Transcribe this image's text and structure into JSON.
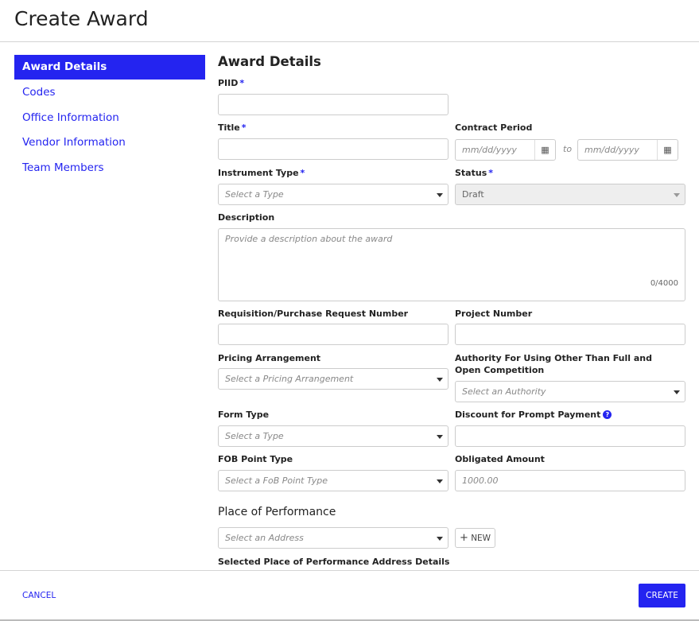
{
  "header": {
    "title": "Create Award"
  },
  "sidebar": {
    "items": [
      {
        "label": "Award Details",
        "active": true
      },
      {
        "label": "Codes"
      },
      {
        "label": "Office Information"
      },
      {
        "label": "Vendor Information"
      },
      {
        "label": "Team Members"
      }
    ]
  },
  "form": {
    "section_title": "Award Details",
    "piid": {
      "label": "PIID",
      "required": "*",
      "value": ""
    },
    "title": {
      "label": "Title",
      "required": "*",
      "value": ""
    },
    "contract_period": {
      "label": "Contract Period",
      "start_placeholder": "mm/dd/yyyy",
      "separator": "to",
      "end_placeholder": "mm/dd/yyyy"
    },
    "instrument_type": {
      "label": "Instrument Type",
      "required": "*",
      "placeholder": "Select a Type"
    },
    "status": {
      "label": "Status",
      "required": "*",
      "value": "Draft"
    },
    "description": {
      "label": "Description",
      "placeholder": "Provide a description about the award",
      "counter": "0/4000"
    },
    "requisition": {
      "label": "Requisition/Purchase Request Number",
      "value": ""
    },
    "project_number": {
      "label": "Project Number",
      "value": ""
    },
    "pricing": {
      "label": "Pricing Arrangement",
      "placeholder": "Select a Pricing Arrangement"
    },
    "authority": {
      "label": "Authority For Using Other Than Full and Open Competition",
      "placeholder": "Select an Authority"
    },
    "form_type": {
      "label": "Form Type",
      "placeholder": "Select a Type"
    },
    "discount": {
      "label": "Discount for Prompt Payment",
      "help": "?",
      "value": ""
    },
    "fob": {
      "label": "FOB Point Type",
      "placeholder": "Select a FoB Point Type"
    },
    "obligated": {
      "label": "Obligated Amount",
      "placeholder": "1000.00"
    },
    "place_title": "Place of Performance",
    "address": {
      "placeholder": "Select an Address"
    },
    "new_label": "NEW",
    "selected_details_label": "Selected Place of Performance Address Details"
  },
  "footer": {
    "cancel": "CANCEL",
    "create": "CREATE"
  },
  "colors": {
    "accent": "#2424f0"
  }
}
